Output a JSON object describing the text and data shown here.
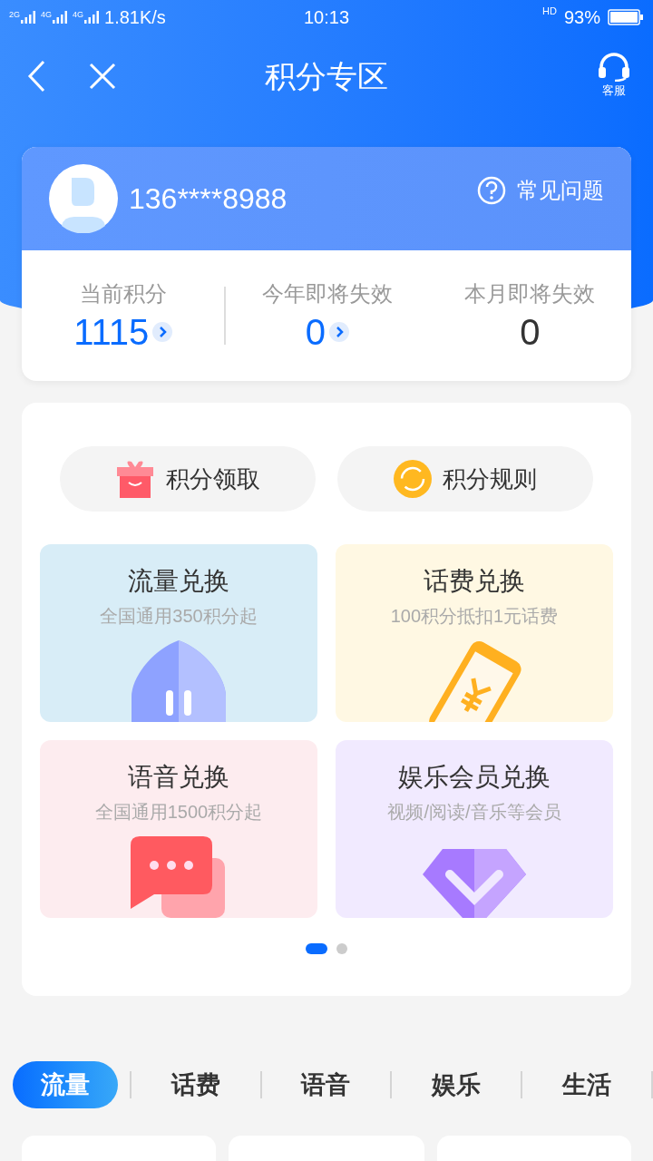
{
  "status_bar": {
    "signal_labels": [
      "2G",
      "4G",
      "4G"
    ],
    "speed": "1.81K/s",
    "time": "10:13",
    "call_label": "HD",
    "battery": "93%"
  },
  "nav": {
    "title": "积分专区",
    "service_label": "客服"
  },
  "account": {
    "phone": "136****8988",
    "faq": "常见问题"
  },
  "points": [
    {
      "label": "当前积分",
      "value": "1115",
      "link": true
    },
    {
      "label": "今年即将失效",
      "value": "0",
      "link": true
    },
    {
      "label": "本月即将失效",
      "value": "0",
      "link": false
    }
  ],
  "actions": [
    {
      "kind": "gift",
      "label": "积分领取"
    },
    {
      "kind": "coin",
      "label": "积分规则"
    }
  ],
  "exchanges": [
    {
      "kind": "data",
      "title": "流量兑换",
      "subtitle": "全国通用350积分起"
    },
    {
      "kind": "bill",
      "title": "话费兑换",
      "subtitle": "100积分抵扣1元话费"
    },
    {
      "kind": "voice",
      "title": "语音兑换",
      "subtitle": "全国通用1500积分起"
    },
    {
      "kind": "member",
      "title": "娱乐会员兑换",
      "subtitle": "视频/阅读/音乐等会员"
    }
  ],
  "pager": [
    {
      "selected": true
    },
    {
      "selected": false
    }
  ],
  "category_tabs": [
    {
      "label": "流量",
      "selected": true
    },
    {
      "label": "话费",
      "selected": false
    },
    {
      "label": "语音",
      "selected": false
    },
    {
      "label": "娱乐",
      "selected": false
    },
    {
      "label": "生活",
      "selected": false
    }
  ]
}
